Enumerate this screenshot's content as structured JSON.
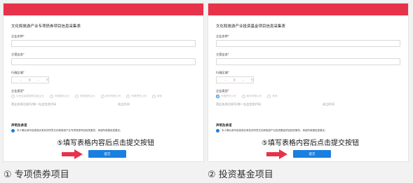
{
  "colors": {
    "accent": "#e8324a",
    "primary": "#1a7fe0"
  },
  "left_panel": {
    "form_title": "文化和旅游产业专项债券项目信息采集表",
    "fields": {
      "company_name": "企业名称",
      "main_business": "主营业务",
      "region": "行政区域",
      "company_type": "企业类型",
      "credit_code": "营业执照注册号/统一社会信用代码",
      "established": "成立时间"
    },
    "region_selects": [
      "省",
      "市"
    ],
    "company_type_options": [
      "中央及省属国有控股企业",
      "市属国有企业",
      "其他国有企业",
      "股份有限公司",
      "有限责任公司",
      "其他"
    ],
    "declaration": {
      "title": "声明及承诺",
      "text": "本人确认填写信息真实有效并同意文化和旅游产业专项债券项目相关服务，承诺所填报信息属实。"
    },
    "hint": "⑤填写表格内容后点击提交按钮",
    "submit_label": "提交",
    "caption": "① 专项债券项目"
  },
  "right_panel": {
    "form_title": "文化和旅游产业投资基金项目信息采集表",
    "fields": {
      "company_name": "企业名称",
      "main_business": "主营业务",
      "region": "行政区域",
      "company_type": "企业类型",
      "credit_code": "营业执照注册号/统一社会信用代码",
      "established": "成立时间"
    },
    "region_selects": [
      "省",
      "市"
    ],
    "company_type_options": [
      "有限责任公司",
      "股份有限公司",
      "其他"
    ],
    "declaration": {
      "title": "声明及承诺",
      "text": "本人确认填写信息真实有效并同意文化和旅游产业投资基金项目相关服务，承诺所填报信息属实。"
    },
    "hint": "⑤填写表格内容后点击提交按钮",
    "submit_label": "提交",
    "caption": "② 投资基金项目"
  }
}
